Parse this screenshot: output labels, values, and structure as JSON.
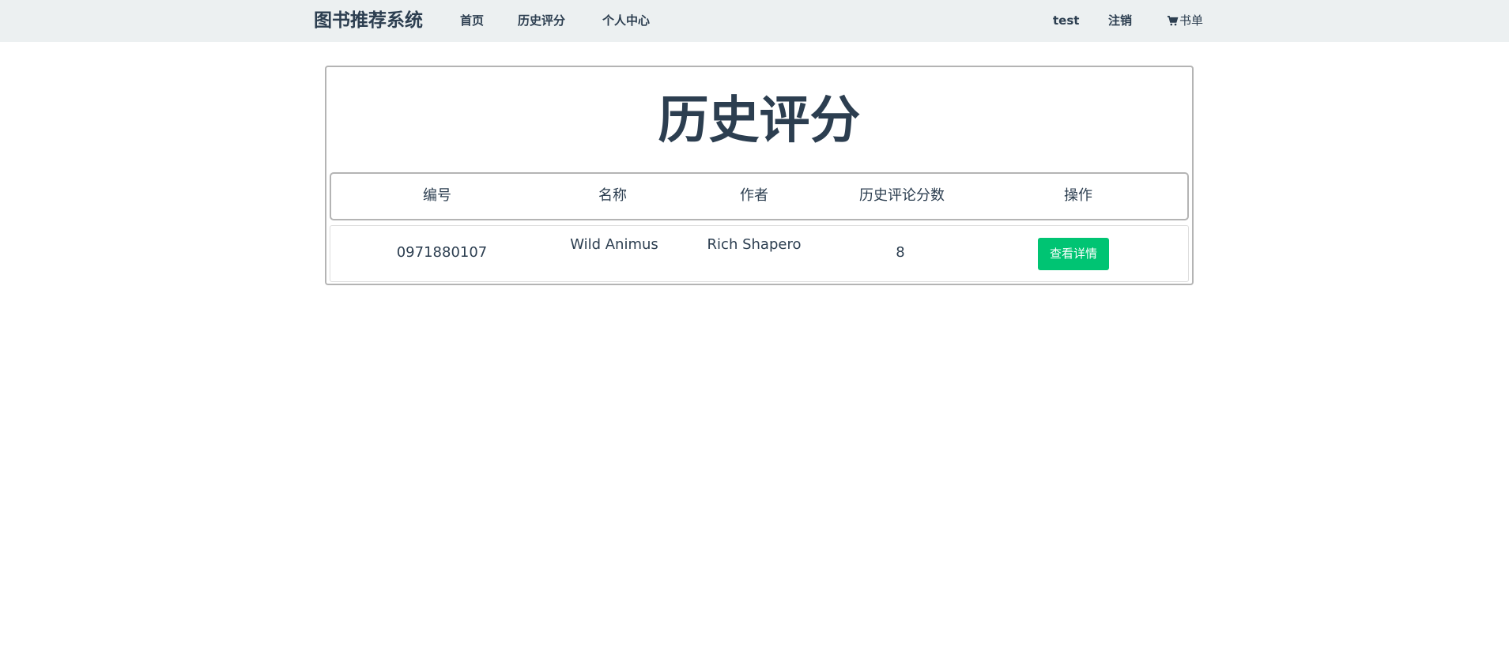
{
  "navbar": {
    "brand": "图书推荐系统",
    "links": {
      "home": "首页",
      "history": "历史评分",
      "profile": "个人中心"
    },
    "user": "test",
    "logout": "注销",
    "cart": {
      "icon": "cart-icon",
      "label": "书单"
    }
  },
  "main": {
    "title": "历史评分",
    "table": {
      "columns": [
        "编号",
        "名称",
        "作者",
        "历史评论分数",
        "操作"
      ],
      "rows": [
        {
          "id": "0971880107",
          "name": "Wild Animus",
          "author": "Rich Shapero",
          "score": "8",
          "action_label": "查看详情"
        }
      ]
    }
  },
  "colors": {
    "navbar_bg": "#ecf0f1",
    "text": "#2c3e50",
    "button": "#00c473"
  }
}
